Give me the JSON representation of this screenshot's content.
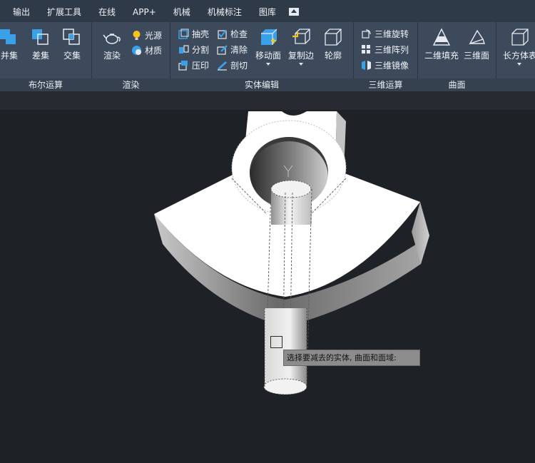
{
  "menu_tabs": [
    "输出",
    "扩展工具",
    "在线",
    "APP+",
    "机械",
    "机械标注",
    "图库"
  ],
  "groups": {
    "boolean": {
      "label": "布尔运算",
      "union": "并集",
      "subtract": "差集",
      "intersect": "交集"
    },
    "render": {
      "label": "渲染",
      "render": "渲染",
      "light": "光源",
      "material": "材质"
    },
    "solid_edit": {
      "label": "实体编辑",
      "shell": "抽壳",
      "check": "检查",
      "separate": "分割",
      "clean": "清除",
      "imprint": "压印",
      "slice": "剖切",
      "move_face": "移动面",
      "copy_edge": "复制边",
      "outline": "轮廓"
    },
    "three_d": {
      "label": "三维运算",
      "rotate3d": "三维旋转",
      "array3d": "三维阵列",
      "mirror3d": "三维镜像"
    },
    "surface": {
      "label": "曲面",
      "fill2d": "二维填充",
      "face3d": "三维面"
    },
    "primitive": {
      "box": "长方体表"
    }
  },
  "prompt": "选择要减去的实体, 曲面和面域:",
  "colors": {
    "menubar": "#2f3a48",
    "ribbon": "#3c4a5c",
    "viewport": "#1e2126",
    "accent_blue": "#3aa0e8"
  }
}
